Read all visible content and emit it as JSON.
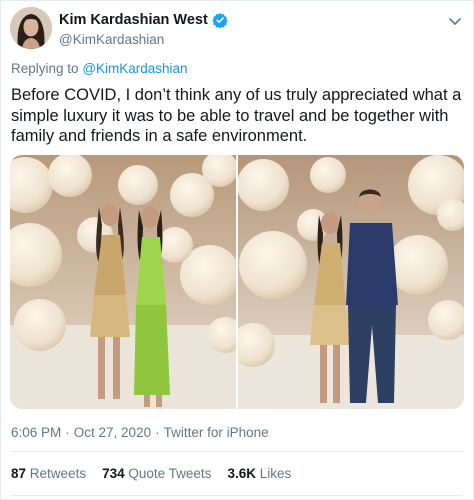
{
  "author": {
    "name": "Kim Kardashian West",
    "handle": "@KimKardashian",
    "verified_icon": "verified-badge-icon",
    "accent": "#1da1f2"
  },
  "reply": {
    "prefix": "Replying to",
    "mention": "@KimKardashian"
  },
  "tweet": {
    "text": "Before COVID, I don’t think any of us truly appreciated what a simple luxury it was to be able to travel and be together with family and friends in a safe environment."
  },
  "meta": {
    "time": "6:06 PM",
    "sep1": "·",
    "date": "Oct 27, 2020",
    "sep2": "·",
    "source": "Twitter for iPhone"
  },
  "stats": {
    "retweets_count": "87",
    "retweets_label": "Retweets",
    "quotes_count": "734",
    "quotes_label": "Quote Tweets",
    "likes_count": "3.6K",
    "likes_label": "Likes"
  },
  "colors": {
    "secondary_text": "#657786",
    "link": "#1b95e0",
    "divider": "#e6ecf0"
  }
}
